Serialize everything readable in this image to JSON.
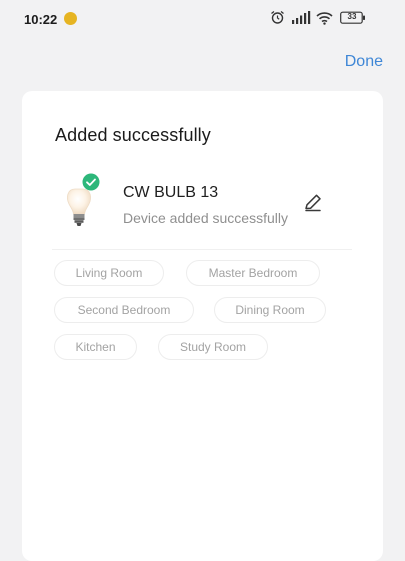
{
  "status_bar": {
    "time": "10:22",
    "battery": "33"
  },
  "header": {
    "done_label": "Done"
  },
  "card": {
    "title": "Added successfully",
    "device": {
      "name": "CW BULB 13",
      "status": "Device added successfully"
    },
    "rooms": [
      "Living Room",
      "Master Bedroom",
      "Second Bedroom",
      "Dining Room",
      "Kitchen",
      "Study Room"
    ]
  },
  "colors": {
    "accent": "#3f87d6",
    "success": "#2db77a",
    "background": "#f2f2f3",
    "card": "#ffffff"
  },
  "icons": {
    "device": "light-bulb-icon",
    "edit": "pencil-icon",
    "success": "check-badge-icon"
  }
}
